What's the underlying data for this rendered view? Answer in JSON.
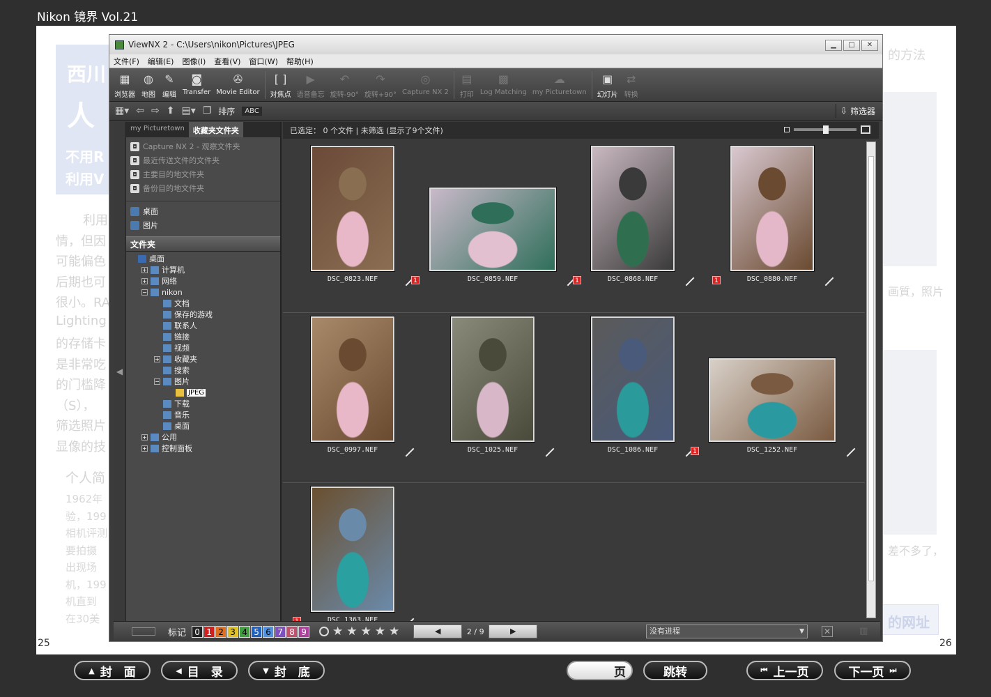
{
  "reader": {
    "title": "Nikon 镜界 Vol.21",
    "left_page": "25",
    "right_page": "26",
    "nav": {
      "cover": "封　面",
      "toc": "目　录",
      "back_cover": "封　底",
      "page_suffix": "页",
      "jump": "跳转",
      "prev": "上一页",
      "next": "下一页"
    }
  },
  "bg_article": {
    "title_frag1": "西川",
    "title_frag2": "人",
    "sub1": "不用R",
    "sub2": "利用V",
    "right_header": "的方法",
    "lines_left": [
      "利用",
      "情，但因",
      "可能偏色",
      "后期也可",
      "很小。RA",
      "Lighting",
      "的存储卡",
      "是非常吃",
      "的门槛降",
      "（S），",
      "筛选照片",
      "显像的技"
    ],
    "profile_head": "个人简",
    "profile_lines": [
      "1962年",
      "验，199",
      "相机评测",
      "要拍摄",
      "出现场",
      "机，199",
      "机直到",
      "在30美"
    ],
    "right_frag1": "画質，照片",
    "right_frag2": "差不多了，",
    "right_link": "的网址"
  },
  "window": {
    "title": "ViewNX 2 - C:\\Users\\nikon\\Pictures\\JPEG",
    "controls": [
      "▁",
      "□",
      "✕"
    ],
    "menu": [
      "文件(F)",
      "编辑(E)",
      "图像(I)",
      "查看(V)",
      "窗口(W)",
      "帮助(H)"
    ],
    "toolbar": [
      {
        "label": "浏览器",
        "icon": "browser-icon",
        "glyph": "▦",
        "dim": false
      },
      {
        "label": "地图",
        "icon": "globe-icon",
        "glyph": "◍",
        "dim": false
      },
      {
        "label": "编辑",
        "icon": "edit-icon",
        "glyph": "✎",
        "dim": false
      },
      {
        "label": "Transfer",
        "icon": "camera-icon",
        "glyph": "◙",
        "dim": false
      },
      {
        "label": "Movie Editor",
        "icon": "film-icon",
        "glyph": "✇",
        "dim": false
      },
      {
        "label": "对焦点",
        "icon": "focus-point-icon",
        "glyph": "[ ]",
        "dim": false
      },
      {
        "label": "语音备忘",
        "icon": "voice-memo-icon",
        "glyph": "▶",
        "dim": true
      },
      {
        "label": "旋转-90°",
        "icon": "rotate-left-icon",
        "glyph": "↶",
        "dim": true
      },
      {
        "label": "旋转+90°",
        "icon": "rotate-right-icon",
        "glyph": "↷",
        "dim": true
      },
      {
        "label": "Capture NX 2",
        "icon": "capture-nx-icon",
        "glyph": "◎",
        "dim": true
      },
      {
        "label": "打印",
        "icon": "print-icon",
        "glyph": "▤",
        "dim": true
      },
      {
        "label": "Log Matching",
        "icon": "log-matching-icon",
        "glyph": "▩",
        "dim": true
      },
      {
        "label": "my Picturetown",
        "icon": "picturetown-icon",
        "glyph": "☁",
        "dim": true
      },
      {
        "label": "幻灯片",
        "icon": "slideshow-icon",
        "glyph": "▣",
        "dim": false
      },
      {
        "label": "转换",
        "icon": "convert-icon",
        "glyph": "⇄",
        "dim": true
      }
    ],
    "toolbar2": {
      "sort_label": "排序",
      "sort_value": "ABC",
      "filter_label": "筛选器"
    },
    "left_panel": {
      "tab_inactive": "my Picturetown",
      "tab_active": "收藏夹文件夹",
      "favorites_dim": [
        "Capture NX 2 - 观察文件夹",
        "最近传送文件的文件夹",
        "主要目的地文件夹",
        "备份目的地文件夹"
      ],
      "favorites": [
        "桌面",
        "图片"
      ],
      "folders_header": "文件夹",
      "tree": [
        {
          "label": "桌面",
          "level": 0,
          "exp": ""
        },
        {
          "label": "计算机",
          "level": 1,
          "exp": "+"
        },
        {
          "label": "网络",
          "level": 1,
          "exp": "+"
        },
        {
          "label": "nikon",
          "level": 1,
          "exp": "−"
        },
        {
          "label": "文档",
          "level": 2,
          "exp": ""
        },
        {
          "label": "保存的游戏",
          "level": 2,
          "exp": ""
        },
        {
          "label": "联系人",
          "level": 2,
          "exp": ""
        },
        {
          "label": "链接",
          "level": 2,
          "exp": ""
        },
        {
          "label": "视频",
          "level": 2,
          "exp": ""
        },
        {
          "label": "收藏夹",
          "level": 2,
          "exp": "+"
        },
        {
          "label": "搜索",
          "level": 2,
          "exp": ""
        },
        {
          "label": "图片",
          "level": 2,
          "exp": "−"
        },
        {
          "label": "JPEG",
          "level": 3,
          "exp": "",
          "selected": true
        },
        {
          "label": "下载",
          "level": 2,
          "exp": ""
        },
        {
          "label": "音乐",
          "level": 2,
          "exp": ""
        },
        {
          "label": "桌面",
          "level": 2,
          "exp": ""
        },
        {
          "label": "公用",
          "level": 1,
          "exp": "+"
        },
        {
          "label": "控制面板",
          "level": 1,
          "exp": "+"
        }
      ]
    },
    "status_text": "已选定： 0 个文件 | 未筛选 (显示了9个文件)",
    "thumbnails": [
      {
        "name": "DSC_0823.NEF",
        "badge": "",
        "orient": "portrait",
        "palette": [
          "#6b4a38",
          "#e8b8c8",
          "#8a6e52"
        ]
      },
      {
        "name": "DSC_0859.NEF",
        "badge": "1",
        "orient": "landscape",
        "palette": [
          "#c9b9c9",
          "#e3c0d0",
          "#2f6f5a"
        ]
      },
      {
        "name": "DSC_0868.NEF",
        "badge": "1",
        "orient": "portrait",
        "palette": [
          "#c9b8c0",
          "#2f6f4f",
          "#3a3a3a"
        ]
      },
      {
        "name": "DSC_0880.NEF",
        "badge": "1",
        "orient": "portrait",
        "palette": [
          "#d8c8d0",
          "#e4b8c8",
          "#6a4a30"
        ]
      },
      {
        "name": "DSC_0997.NEF",
        "badge": "",
        "orient": "portrait",
        "palette": [
          "#a88a6a",
          "#e8b8c8",
          "#6a4a30"
        ]
      },
      {
        "name": "DSC_1025.NEF",
        "badge": "",
        "orient": "portrait",
        "palette": [
          "#8a8a7a",
          "#d8b8c8",
          "#4a4a3a"
        ]
      },
      {
        "name": "DSC_1086.NEF",
        "badge": "",
        "orient": "portrait",
        "palette": [
          "#5a5a5a",
          "#2a9a9a",
          "#4a5a7a"
        ]
      },
      {
        "name": "DSC_1252.NEF",
        "badge": "1",
        "orient": "landscape",
        "palette": [
          "#d8d0c8",
          "#2a9aa0",
          "#7a5a40"
        ]
      },
      {
        "name": "DSC_1363.NEF",
        "badge": "1",
        "orient": "portrait",
        "palette": [
          "#6a5030",
          "#2aa0a0",
          "#6a8aaa"
        ]
      }
    ],
    "bottom": {
      "label_title": "标记",
      "labels": [
        {
          "n": "0",
          "bg": "#222222",
          "fg": "#ffffff"
        },
        {
          "n": "1",
          "bg": "#d02020",
          "fg": "#ffffff"
        },
        {
          "n": "2",
          "bg": "#e07020",
          "fg": "#000000"
        },
        {
          "n": "3",
          "bg": "#e0c020",
          "fg": "#000000"
        },
        {
          "n": "4",
          "bg": "#40a040",
          "fg": "#000000"
        },
        {
          "n": "5",
          "bg": "#2060c0",
          "fg": "#ffffff"
        },
        {
          "n": "6",
          "bg": "#5090e0",
          "fg": "#000000"
        },
        {
          "n": "7",
          "bg": "#8050c0",
          "fg": "#ffffff"
        },
        {
          "n": "8",
          "bg": "#c05070",
          "fg": "#ffffff"
        },
        {
          "n": "9",
          "bg": "#b040a0",
          "fg": "#ffffff"
        }
      ],
      "no_rating": "⃠",
      "stars": [
        "★",
        "★",
        "★",
        "★",
        "★"
      ],
      "page_indicator": "2 / 9",
      "prev_glyph": "◀",
      "next_glyph": "▶",
      "progress": "没有进程"
    }
  }
}
